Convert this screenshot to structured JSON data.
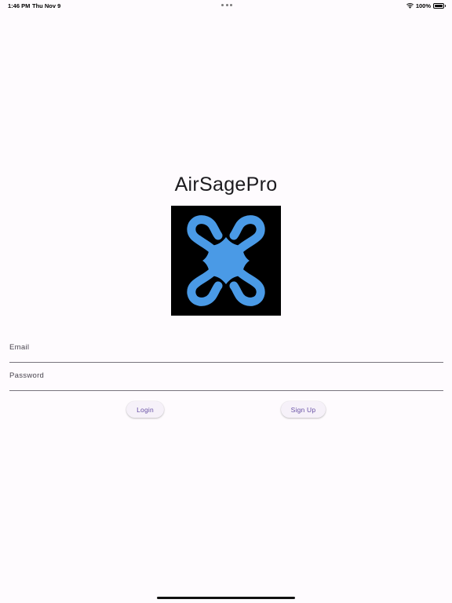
{
  "status_bar": {
    "time": "1:46 PM",
    "date": "Thu Nov 9",
    "battery_percent": "100%",
    "battery_level": 1.0,
    "icons": [
      "more-dots-icon",
      "wifi-icon",
      "battery-icon"
    ]
  },
  "app": {
    "title": "AirSagePro",
    "logo_icon": "drone-icon",
    "colors": {
      "logo_background": "#000000",
      "logo_drone": "#4a9ae6",
      "button_text": "#6750a4",
      "page_background": "#fefbfe"
    }
  },
  "form": {
    "email_label": "Email",
    "email_value": "",
    "password_label": "Password",
    "password_value": ""
  },
  "buttons": {
    "login_label": "Login",
    "signup_label": "Sign Up"
  }
}
